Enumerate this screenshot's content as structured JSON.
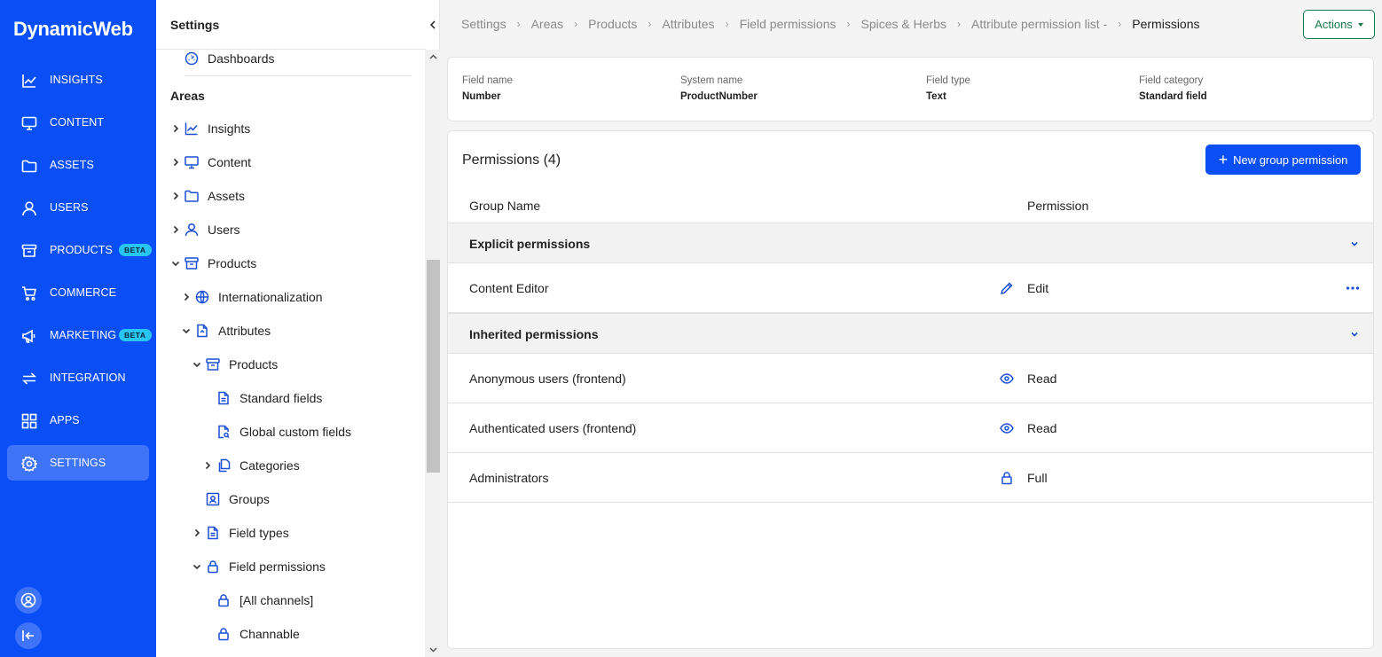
{
  "app": {
    "logo": "DynamicWeb"
  },
  "nav": {
    "items": [
      {
        "label": "INSIGHTS",
        "icon": "chart-line-icon"
      },
      {
        "label": "CONTENT",
        "icon": "monitor-icon"
      },
      {
        "label": "ASSETS",
        "icon": "folder-icon"
      },
      {
        "label": "USERS",
        "icon": "user-icon"
      },
      {
        "label": "PRODUCTS",
        "icon": "archive-box-icon",
        "badge": "BETA"
      },
      {
        "label": "COMMERCE",
        "icon": "cart-icon"
      },
      {
        "label": "MARKETING",
        "icon": "megaphone-icon",
        "badge": "BETA"
      },
      {
        "label": "INTEGRATION",
        "icon": "arrows-exchange-icon"
      },
      {
        "label": "APPS",
        "icon": "apps-grid-icon"
      },
      {
        "label": "SETTINGS",
        "icon": "gear-icon",
        "active": true
      }
    ],
    "active_color": "#3f74f8",
    "rail_color": "#0a4ff5",
    "badge_color": "#28c6ee"
  },
  "tree": {
    "title": "Settings",
    "dashboards": "Dashboards",
    "areas_heading": "Areas",
    "items": [
      {
        "label": "Insights"
      },
      {
        "label": "Content"
      },
      {
        "label": "Assets"
      },
      {
        "label": "Users"
      },
      {
        "label": "Products"
      },
      {
        "label": "Internationalization"
      },
      {
        "label": "Attributes"
      },
      {
        "label": "Products"
      },
      {
        "label": "Standard fields"
      },
      {
        "label": "Global custom fields"
      },
      {
        "label": "Categories"
      },
      {
        "label": "Groups"
      },
      {
        "label": "Field types"
      },
      {
        "label": "Field permissions"
      },
      {
        "label": "[All channels]"
      },
      {
        "label": "Channable"
      }
    ]
  },
  "breadcrumb": [
    "Settings",
    "Areas",
    "Products",
    "Attributes",
    "Field permissions",
    "Spices & Herbs",
    "Attribute permission list -",
    "Permissions"
  ],
  "actions_label": "Actions",
  "field_info": {
    "field_name_label": "Field name",
    "field_name": "Number",
    "system_name_label": "System name",
    "system_name": "ProductNumber",
    "field_type_label": "Field type",
    "field_type": "Text",
    "field_category_label": "Field category",
    "field_category": "Standard field"
  },
  "permissions": {
    "title": "Permissions (4)",
    "new_button": "New group permission",
    "col_group": "Group Name",
    "col_permission": "Permission",
    "explicit_heading": "Explicit permissions",
    "inherited_heading": "Inherited permissions",
    "explicit": [
      {
        "group": "Content Editor",
        "permission": "Edit",
        "icon": "pencil-icon"
      }
    ],
    "inherited": [
      {
        "group": "Anonymous users (frontend)",
        "permission": "Read",
        "icon": "eye-icon"
      },
      {
        "group": "Authenticated users (frontend)",
        "permission": "Read",
        "icon": "eye-icon"
      },
      {
        "group": "Administrators",
        "permission": "Full",
        "icon": "lock-icon"
      }
    ]
  },
  "colors": {
    "primary": "#0a4ff5",
    "actions_green": "#167a4a"
  }
}
